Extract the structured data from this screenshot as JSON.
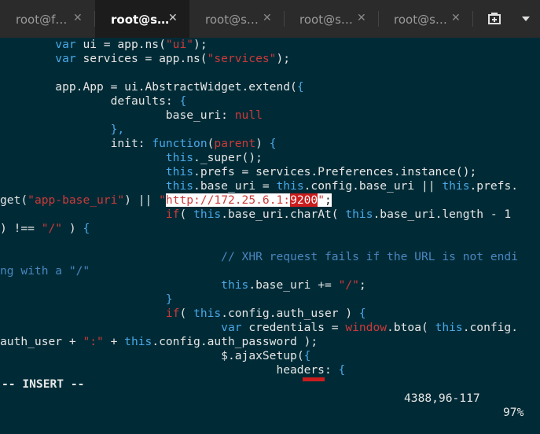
{
  "tabs": [
    {
      "label": "root@f…",
      "active": false
    },
    {
      "label": "root@s…",
      "active": true
    },
    {
      "label": "root@s…",
      "active": false
    },
    {
      "label": "root@s…",
      "active": false
    },
    {
      "label": "root@s…",
      "active": false
    }
  ],
  "toolbar": {
    "new_tab_icon": "new-tab-icon",
    "menu_icon": "chevron-down-icon"
  },
  "code_lines": [
    {
      "indent": "        ",
      "segs": [
        [
          "var",
          "kw"
        ],
        [
          " ui = app.ns(",
          ""
        ],
        [
          "\"ui\"",
          "str"
        ],
        [
          ");",
          ""
        ]
      ]
    },
    {
      "indent": "        ",
      "segs": [
        [
          "var",
          "kw"
        ],
        [
          " services = app.ns(",
          ""
        ],
        [
          "\"services\"",
          "str"
        ],
        [
          ");",
          ""
        ]
      ]
    },
    {
      "indent": "",
      "segs": []
    },
    {
      "indent": "        ",
      "segs": [
        [
          "app.App = ui.AbstractWidget.extend(",
          ""
        ],
        [
          "{",
          "paren"
        ]
      ]
    },
    {
      "indent": "                ",
      "segs": [
        [
          "defaults: ",
          ""
        ],
        [
          "{",
          "paren"
        ]
      ]
    },
    {
      "indent": "                        ",
      "segs": [
        [
          "base_uri: ",
          ""
        ],
        [
          "null",
          "str"
        ]
      ]
    },
    {
      "indent": "                ",
      "segs": [
        [
          "},",
          "paren"
        ]
      ]
    },
    {
      "indent": "                ",
      "segs": [
        [
          "init: ",
          ""
        ],
        [
          "function",
          "kw"
        ],
        [
          "(",
          ""
        ],
        [
          "parent",
          "str"
        ],
        [
          ") ",
          ""
        ],
        [
          "{",
          "paren"
        ]
      ]
    },
    {
      "indent": "                        ",
      "segs": [
        [
          "this",
          "kw"
        ],
        [
          "._super();",
          ""
        ]
      ]
    },
    {
      "indent": "                        ",
      "segs": [
        [
          "this",
          "kw"
        ],
        [
          ".prefs = services.Preferences.instance();",
          ""
        ]
      ]
    },
    {
      "indent": "                        ",
      "segs": [
        [
          "this",
          "kw"
        ],
        [
          ".base_uri = ",
          ""
        ],
        [
          "this",
          "kw"
        ],
        [
          ".config.base_uri || ",
          ""
        ],
        [
          "this",
          "kw"
        ],
        [
          ".prefs.",
          ""
        ]
      ]
    },
    {
      "indent": "",
      "segs": [
        [
          "get(",
          ""
        ],
        [
          "\"app-base_uri\"",
          "str"
        ],
        [
          ") || ",
          ""
        ],
        [
          "\"",
          "str"
        ],
        [
          "http://172.25.6.1",
          "hl"
        ],
        [
          ":",
          "hl"
        ],
        [
          "9200",
          "hl2"
        ],
        [
          "\"",
          "hl"
        ],
        [
          ";",
          "hlt"
        ]
      ]
    },
    {
      "indent": "                        ",
      "segs": [
        [
          "if",
          "str"
        ],
        [
          "( ",
          ""
        ],
        [
          "this",
          "kw"
        ],
        [
          ".base_uri.charAt( ",
          ""
        ],
        [
          "this",
          "kw"
        ],
        [
          ".base_uri.length - 1",
          ""
        ]
      ]
    },
    {
      "indent": "",
      "segs": [
        [
          ") !== ",
          ""
        ],
        [
          "\"/\"",
          "str"
        ],
        [
          " ) ",
          ""
        ],
        [
          "{",
          "paren"
        ]
      ]
    },
    {
      "indent": "",
      "segs": []
    },
    {
      "indent": "                                ",
      "segs": [
        [
          "// XHR request fails if the URL is not endi",
          "cm"
        ]
      ]
    },
    {
      "indent": "",
      "segs": [
        [
          "ng with a \"/\"",
          "cm"
        ]
      ]
    },
    {
      "indent": "                                ",
      "segs": [
        [
          "this",
          "kw"
        ],
        [
          ".base_uri += ",
          ""
        ],
        [
          "\"/\"",
          "str"
        ],
        [
          ";",
          ""
        ]
      ]
    },
    {
      "indent": "                        ",
      "segs": [
        [
          "}",
          "paren"
        ]
      ]
    },
    {
      "indent": "                        ",
      "segs": [
        [
          "if",
          "str"
        ],
        [
          "( ",
          ""
        ],
        [
          "this",
          "kw"
        ],
        [
          ".config.auth_user ) ",
          ""
        ],
        [
          "{",
          "paren"
        ]
      ]
    },
    {
      "indent": "                                ",
      "segs": [
        [
          "var",
          "kw"
        ],
        [
          " credentials = ",
          ""
        ],
        [
          "window",
          "str"
        ],
        [
          ".btoa( ",
          ""
        ],
        [
          "this",
          "kw"
        ],
        [
          ".config.",
          ""
        ]
      ]
    },
    {
      "indent": "",
      "segs": [
        [
          "auth_user + ",
          ""
        ],
        [
          "\":\"",
          "str"
        ],
        [
          " + ",
          ""
        ],
        [
          "this",
          "kw"
        ],
        [
          ".config.auth_password );",
          ""
        ]
      ]
    },
    {
      "indent": "                                ",
      "segs": [
        [
          "$.ajaxSetup(",
          ""
        ],
        [
          "{",
          "paren"
        ]
      ]
    },
    {
      "indent": "                                        ",
      "segs": [
        [
          "headers: ",
          ""
        ],
        [
          "{",
          "paren"
        ]
      ]
    }
  ],
  "status": {
    "mode": "-- INSERT --",
    "position": "4388,96-117",
    "percent": "97%"
  }
}
